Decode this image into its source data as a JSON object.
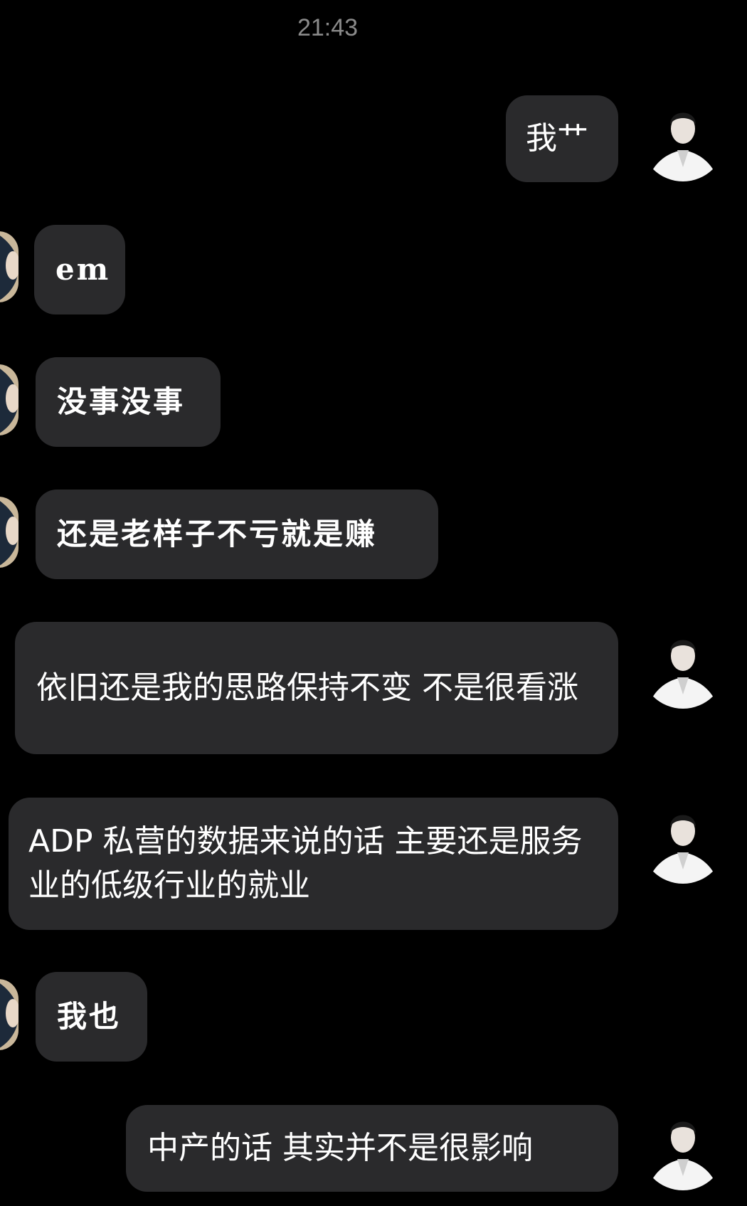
{
  "chat": {
    "timestamp": "21:43",
    "messages": [
      {
        "side": "out",
        "text": "我艹"
      },
      {
        "side": "in",
        "text": "em"
      },
      {
        "side": "in",
        "text": "没事没事"
      },
      {
        "side": "in",
        "text": "还是老样子不亏就是赚"
      },
      {
        "side": "out",
        "text": "依旧还是我的思路保持不变 不是很看涨"
      },
      {
        "side": "out",
        "text": "ADP 私营的数据来说的话 主要还是服务业的低级行业的就业"
      },
      {
        "side": "in",
        "text": "我也"
      },
      {
        "side": "out",
        "text": "中产的话 其实并不是很影响"
      }
    ]
  },
  "colors": {
    "background": "#000000",
    "bubble": "#2a2a2c",
    "timestamp": "#8a8a8a",
    "text": "#ffffff"
  },
  "icons": {
    "outgoing_avatar": "user-avatar-icon",
    "incoming_avatar": "contact-avatar-icon"
  }
}
